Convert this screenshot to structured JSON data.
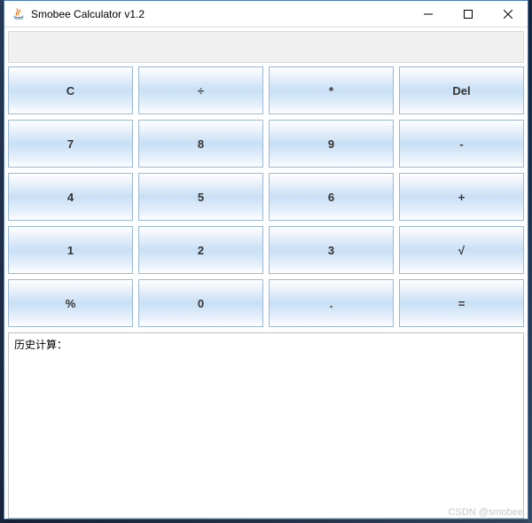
{
  "window": {
    "title": "Smobee Calculator v1.2"
  },
  "display": {
    "value": ""
  },
  "buttons": {
    "row0": {
      "c0": "C",
      "c1": "÷",
      "c2": "*",
      "c3": "Del"
    },
    "row1": {
      "c0": "7",
      "c1": "8",
      "c2": "9",
      "c3": "-"
    },
    "row2": {
      "c0": "4",
      "c1": "5",
      "c2": "6",
      "c3": "+"
    },
    "row3": {
      "c0": "1",
      "c1": "2",
      "c2": "3",
      "c3": "√"
    },
    "row4": {
      "c0": "%",
      "c1": "0",
      "c2": ".",
      "c3": "="
    }
  },
  "history": {
    "label": "历史计算："
  },
  "watermark": "CSDN @smobee"
}
